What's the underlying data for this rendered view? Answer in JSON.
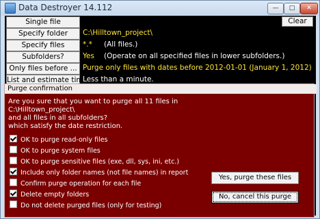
{
  "window": {
    "title": "Data Destroyer 14.112"
  },
  "titlebar_buttons": {
    "minimize": "—",
    "maximize": "□",
    "close": "✕"
  },
  "controls": {
    "clear_label": "Clear",
    "rows": [
      {
        "button": "Single file",
        "value": ""
      },
      {
        "button": "Specify folder",
        "value": "C:\\Hilltown_project\\"
      },
      {
        "button": "Specify files",
        "value": "*.*",
        "note": "(All files.)"
      },
      {
        "button": "Subfolders?",
        "value": "Yes",
        "note": "(Operate on all specified files in lower subfolders.)"
      },
      {
        "button": "Only files before ...",
        "value": "Purge only files with dates before 2012-01-01 (January 1, 2012)"
      },
      {
        "button": "List and estimate time",
        "value": "Less than a minute."
      }
    ]
  },
  "dialog": {
    "title": "Purge confirmation",
    "message": [
      "Are you sure that you want to purge all 11 files in",
      "C:\\Hilltown_project\\",
      "and all files in all subfolders?",
      "which satisfy the date restriction."
    ],
    "options": [
      {
        "label": "OK to purge read-only files",
        "checked": true
      },
      {
        "label": "OK to purge system files",
        "checked": false
      },
      {
        "label": "OK to purge sensitive files (exe, dll, sys, ini, etc.)",
        "checked": false
      },
      {
        "label": "Include only folder names (not file names) in report",
        "checked": true
      },
      {
        "label": "Confirm purge operation for each file",
        "checked": false
      },
      {
        "label": "Delete empty folders",
        "checked": true
      },
      {
        "label": "Do not delete purged files (only for testing)",
        "checked": false
      }
    ],
    "yes_label": "Yes, purge these files",
    "no_label": "No, cancel this purge"
  }
}
